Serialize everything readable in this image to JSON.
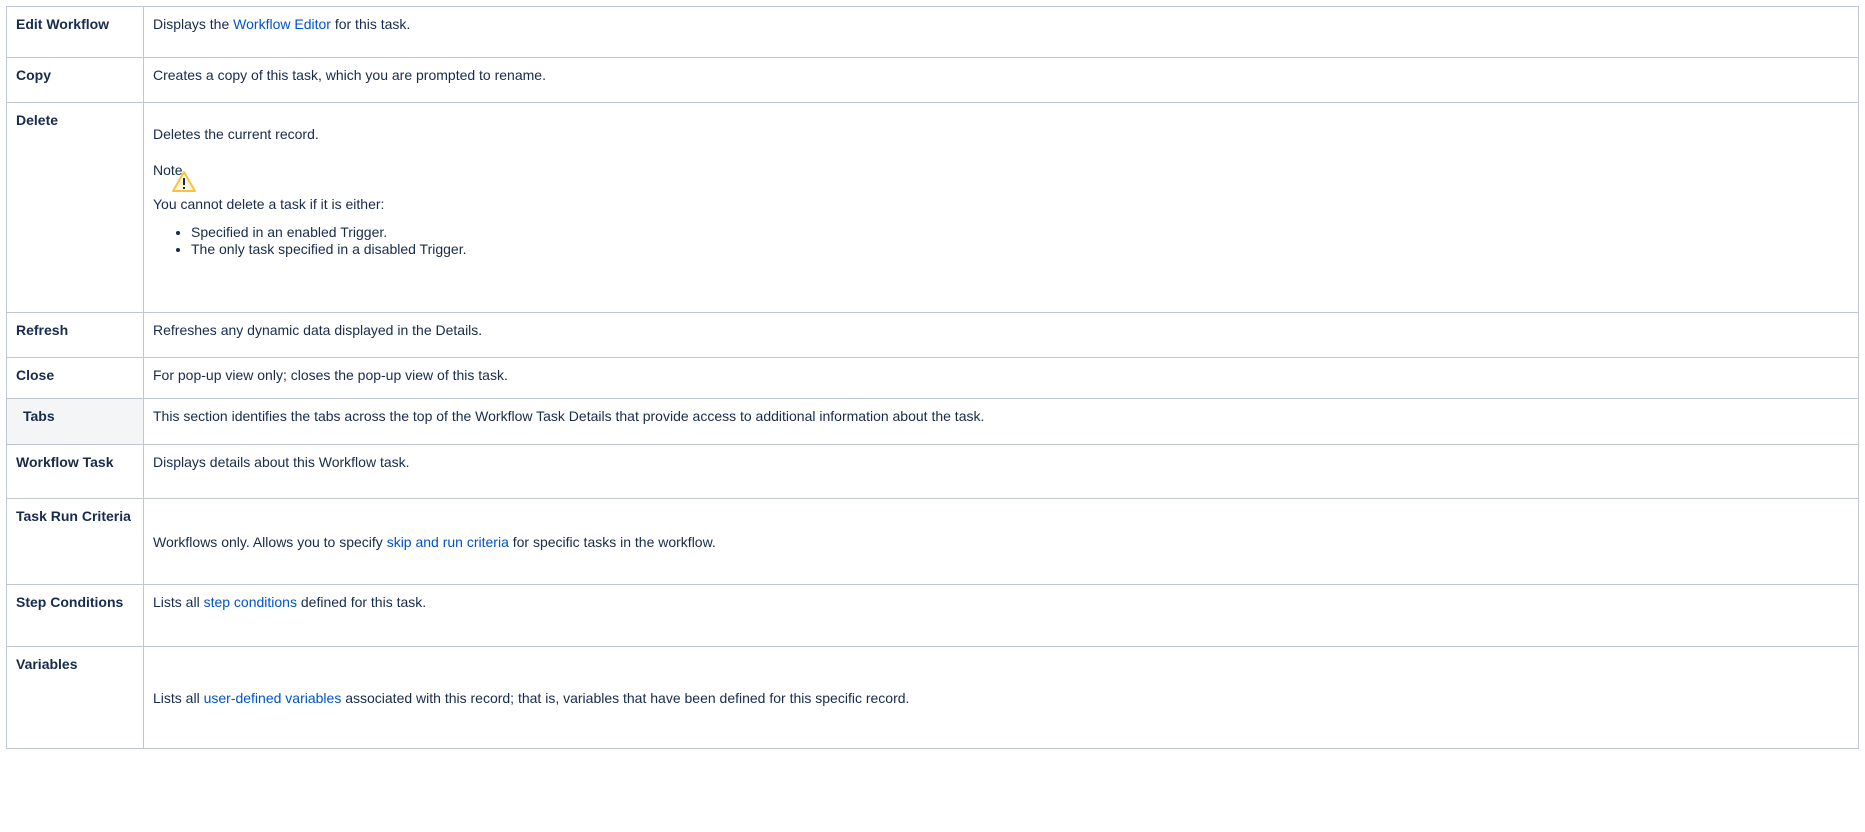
{
  "rows": {
    "edit_workflow": {
      "label": "Edit Workflow",
      "text_before": "Displays the ",
      "link": "Workflow Editor",
      "text_after": " for this task."
    },
    "copy": {
      "label": "Copy",
      "text": "Creates a copy of this task, which you are prompted to rename."
    },
    "delete": {
      "label": "Delete",
      "text": "Deletes the current record.",
      "note_title": "Note",
      "note_icon": "warning-icon",
      "note_text": "You cannot delete a task if it is either:",
      "bullets": [
        "Specified in an enabled Trigger.",
        "The only task specified in a disabled Trigger."
      ]
    },
    "refresh": {
      "label": "Refresh",
      "text": "Refreshes any dynamic data displayed in the Details."
    },
    "close": {
      "label": "Close",
      "text": "For pop-up view only; closes the pop-up view of this task."
    },
    "tabs": {
      "label": "Tabs",
      "text": "This section identifies the tabs across the top of the Workflow Task Details that provide access to additional information about the task."
    },
    "workflow_task": {
      "label": "Workflow Task",
      "text": "Displays details about this Workflow task."
    },
    "task_run_criteria": {
      "label": "Task Run Criteria",
      "text_before": "Workflows only. Allows you to specify ",
      "link": "skip and run criteria",
      "text_after": " for specific tasks in the workflow."
    },
    "step_conditions": {
      "label": "Step Conditions",
      "text_before": "Lists all ",
      "link": "step conditions",
      "text_after": " defined for this task."
    },
    "variables": {
      "label": "Variables",
      "text_before": "Lists all ",
      "link": "user-defined variables",
      "text_after": " associated with this record; that is, variables that have been defined for this specific record."
    }
  },
  "colors": {
    "link": "#0052cc",
    "border": "#c1c7d0",
    "section_bg": "#f4f5f7",
    "warning": "#f6c342"
  }
}
